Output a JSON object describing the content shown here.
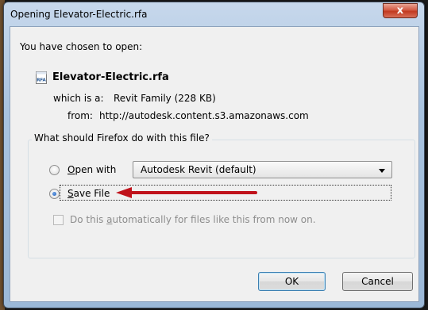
{
  "window": {
    "title": "Opening Elevator-Electric.rfa",
    "close_label": "x"
  },
  "body": {
    "intro": "You have chosen to open:",
    "file_icon_label": "RFA",
    "filename": "Elevator-Electric.rfa",
    "type_prefix": "which is a:",
    "type_value": "Revit Family (228 KB)",
    "from_prefix": "from:",
    "from_value": "http://autodesk.content.s3.amazonaws.com"
  },
  "options": {
    "legend": "What should Firefox do with this file?",
    "open_with_mnemonic": "O",
    "open_with_rest": "pen with",
    "open_with_selected": "Autodesk Revit (default)",
    "save_file_mnemonic": "S",
    "save_file_rest": "ave File",
    "selected_option": "save_file",
    "auto_prefix": "Do this ",
    "auto_mnemonic": "a",
    "auto_rest": "utomatically for files like this from now on.",
    "auto_checked": false
  },
  "buttons": {
    "ok": "OK",
    "cancel": "Cancel"
  },
  "colors": {
    "annotation_arrow": "#c0121b"
  }
}
